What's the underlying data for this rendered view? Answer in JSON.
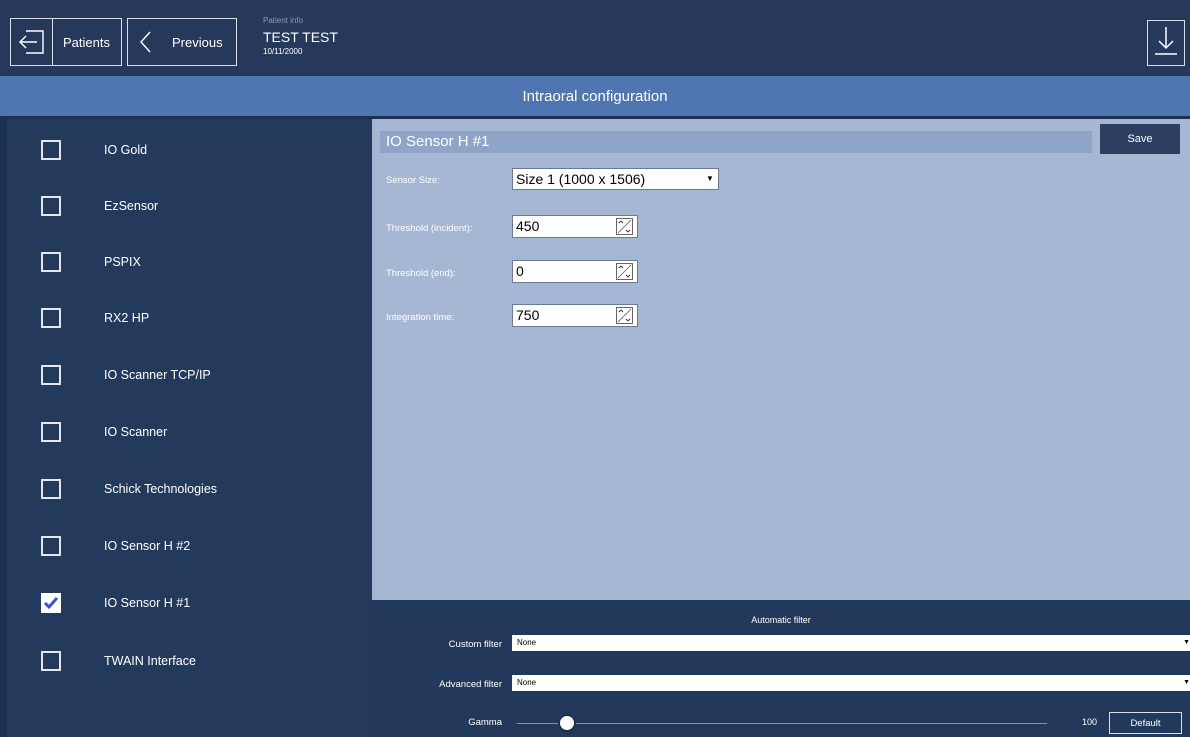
{
  "header": {
    "patients_label": "Patients",
    "previous_label": "Previous",
    "patient_info_caption": "Patient info",
    "patient_name": "TEST TEST",
    "patient_date": "10/11/2000"
  },
  "title": "Intraoral configuration",
  "sidebar": {
    "items": [
      {
        "label": "IO Gold",
        "checked": false
      },
      {
        "label": "EzSensor",
        "checked": false
      },
      {
        "label": "PSPIX",
        "checked": false
      },
      {
        "label": "RX2 HP",
        "checked": false
      },
      {
        "label": "IO Scanner TCP/IP",
        "checked": false
      },
      {
        "label": "IO Scanner",
        "checked": false
      },
      {
        "label": "Schick Technologies",
        "checked": false
      },
      {
        "label": "IO Sensor H #2",
        "checked": false
      },
      {
        "label": "IO Sensor H #1",
        "checked": true
      },
      {
        "label": "TWAIN Interface",
        "checked": false
      }
    ]
  },
  "sensor": {
    "title": "IO Sensor H #1",
    "save_label": "Save",
    "sensor_size_label": "Sensor Size:",
    "sensor_size_value": "Size 1 (1000 x 1506)",
    "threshold_incident_label": "Threshold (incident):",
    "threshold_incident_value": "450",
    "threshold_end_label": "Threshold (end):",
    "threshold_end_value": "0",
    "integration_time_label": "Integration time:",
    "integration_time_value": "750"
  },
  "filter": {
    "title": "Automatic filter",
    "custom_label": "Custom filter",
    "custom_value": "None",
    "advanced_label": "Advanced filter",
    "advanced_value": "None",
    "gamma_label": "Gamma",
    "gamma_value": "100",
    "default_label": "Default"
  },
  "colors": {
    "header_bg": "#26395a",
    "title_bar": "#4f76b0",
    "sidebar_bg": "#243a5c",
    "main_bg": "#a6b7d4",
    "check_accent": "#3b4fd8"
  },
  "icons": {
    "patients": "exit-arrow-icon",
    "previous": "chevron-left-icon",
    "download": "download-arrow-icon",
    "checkbox_checked": "checkmark-icon",
    "spin": "spin-arrows-icon"
  }
}
